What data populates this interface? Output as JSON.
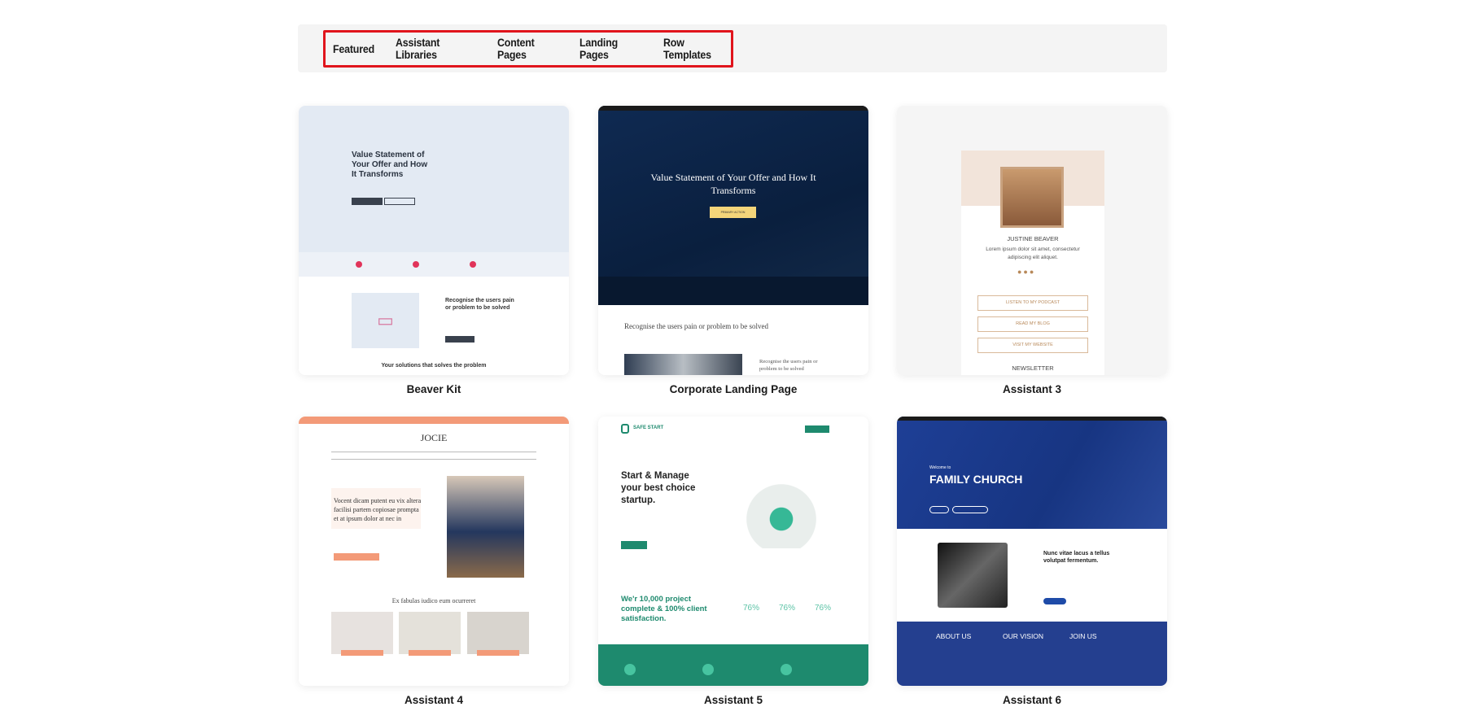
{
  "tabs": [
    {
      "label": "Featured"
    },
    {
      "label": "Assistant Libraries"
    },
    {
      "label": "Content Pages"
    },
    {
      "label": "Landing Pages"
    },
    {
      "label": "Row Templates"
    }
  ],
  "colors": {
    "highlight_box": "#e0141c",
    "tabbar_bg": "#f4f4f4"
  },
  "templates": [
    {
      "name": "Beaver Kit",
      "hero_title": "Value Statement of Your Offer and How It Transforms",
      "section_title": "Recognise the users pain or problem to be solved",
      "footer_title": "Your solutions that solves the problem"
    },
    {
      "name": "Corporate Landing Page",
      "hero_title": "Value Statement of Your Offer and How It Transforms",
      "hero_button": "PRIMARY ACTION",
      "section_title": "Recognise the users pain or problem to be solved",
      "side_text": "Recognise the users pain or problem to be solved"
    },
    {
      "name": "Assistant 3",
      "person": "JUSTINE BEAVER",
      "bio": "Lorem ipsum dolor sit amet, consectetur adipiscing elit aliquet.",
      "buttons": [
        "LISTEN TO MY PODCAST",
        "READ MY BLOG",
        "VISIT MY WEBSITE"
      ],
      "newsletter": "NEWSLETTER"
    },
    {
      "name": "Assistant 4",
      "logo": "JOCIE",
      "hero_text": "Vocent dicam putent eu vix altera facilisi partem copiosae prompta et at ipsum dolor at nec in",
      "section_title": "Ex fabulas iudico eum ocurreret"
    },
    {
      "name": "Assistant 5",
      "logo": "SAFE START",
      "hero_title": "Start & Manage your best choice startup.",
      "stats_title": "We'r 10,000 project complete & 100% client satisfaction.",
      "stats": [
        "76%",
        "76%",
        "76%"
      ]
    },
    {
      "name": "Assistant 6",
      "welcome": "Welcome to",
      "hero_title": "FAMILY CHURCH",
      "section_title": "Nunc vitae lacus a tellus volutpat fermentum.",
      "columns": [
        "ABOUT US",
        "OUR VISION",
        "JOIN US"
      ]
    }
  ]
}
